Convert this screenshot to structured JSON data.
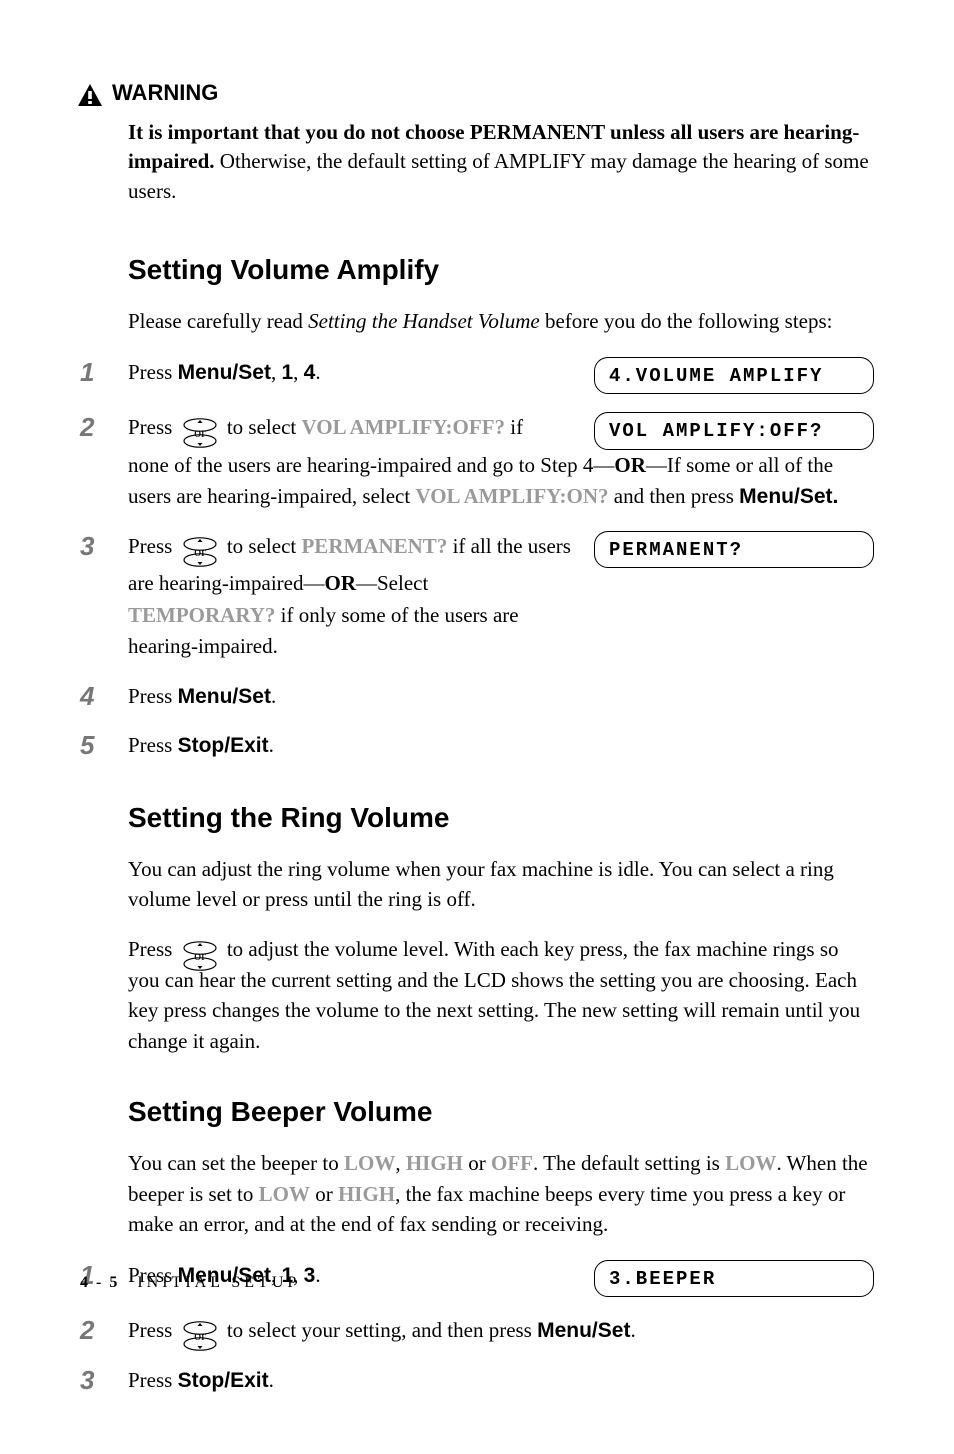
{
  "warning": {
    "label": "WARNING",
    "bold_prefix": "It is important that you do not choose PERMANENT unless all users are hearing-impaired.",
    "rest": " Otherwise, the default setting of AMPLIFY may damage the hearing of some users."
  },
  "amplify": {
    "heading": "Setting Volume Amplify",
    "intro_pre": "Please carefully read ",
    "intro_italic": "Setting the Handset Volume",
    "intro_post": " before you do the following steps:",
    "steps": {
      "s1": {
        "num": "1",
        "t1": "Press ",
        "k1": "Menu/Set",
        "t2": ", ",
        "k2": "1",
        "t3": ", ",
        "k3": "4",
        "t4": ".",
        "lcd": "4.VOLUME AMPLIFY"
      },
      "s2": {
        "num": "2",
        "t1": "Press ",
        "t2": " to select ",
        "g1": "VOL AMPLIFY:OFF?",
        "t3": " if none of the users are hearing-impaired and go to Step 4—",
        "or1": "OR",
        "t4": "—If some or all of the users are hearing-impaired, select ",
        "g2": "VOL AMPLIFY:ON?",
        "t5": " and then press ",
        "k1": "Menu/Set.",
        "lcd": "VOL AMPLIFY:OFF?"
      },
      "s3": {
        "num": "3",
        "t1": "Press ",
        "t2": " to select ",
        "g1": "PERMANENT?",
        "t3": " if all the users are hearing-impaired—",
        "or1": "OR",
        "t4": "—Select ",
        "g2": "TEMPORARY?",
        "t5": " if only some of the users are hearing-impaired.",
        "lcd": "PERMANENT?"
      },
      "s4": {
        "num": "4",
        "t1": "Press ",
        "k1": "Menu/Set",
        "t2": "."
      },
      "s5": {
        "num": "5",
        "t1": "Press ",
        "k1": "Stop/Exit",
        "t2": "."
      }
    }
  },
  "ring": {
    "heading": "Setting the Ring Volume",
    "p1": "You can adjust the ring volume when your fax machine is idle. You can select a ring volume level or press until the ring is off.",
    "p2_pre": "Press ",
    "p2_post": " to adjust the volume level. With each key press, the fax machine rings so you can hear the current setting and the LCD shows the setting you are choosing. Each key press changes the volume to the next setting. The new setting will remain until you change it again."
  },
  "beeper": {
    "heading": "Setting Beeper Volume",
    "p1_t1": "You can set the beeper to ",
    "p1_g1": "LOW",
    "p1_t2": ", ",
    "p1_g2": "HIGH",
    "p1_t3": " or ",
    "p1_g3": "OFF",
    "p1_t4": ". The default setting is ",
    "p1_g4": "LOW",
    "p1_t5": ". When the beeper is set to ",
    "p1_g5": "LOW",
    "p1_t6": " or ",
    "p1_g6": "HIGH",
    "p1_t7": ", the fax machine beeps every time you press a key or make an error, and at the end of fax sending or receiving.",
    "steps": {
      "s1": {
        "num": "1",
        "t1": "Press ",
        "k1": "Menu/Set",
        "t2": ", ",
        "k2": "1",
        "t3": ", ",
        "k3": "3",
        "t4": ".",
        "lcd": "3.BEEPER"
      },
      "s2": {
        "num": "2",
        "t1": "Press ",
        "t2": " to select your setting, and then press ",
        "k1": "Menu/Set",
        "t3": "."
      },
      "s3": {
        "num": "3",
        "t1": "Press ",
        "k1": "Stop/Exit",
        "t2": "."
      }
    }
  },
  "footer": {
    "page": "4 - 5",
    "chapter": "INITIAL SETUP"
  }
}
